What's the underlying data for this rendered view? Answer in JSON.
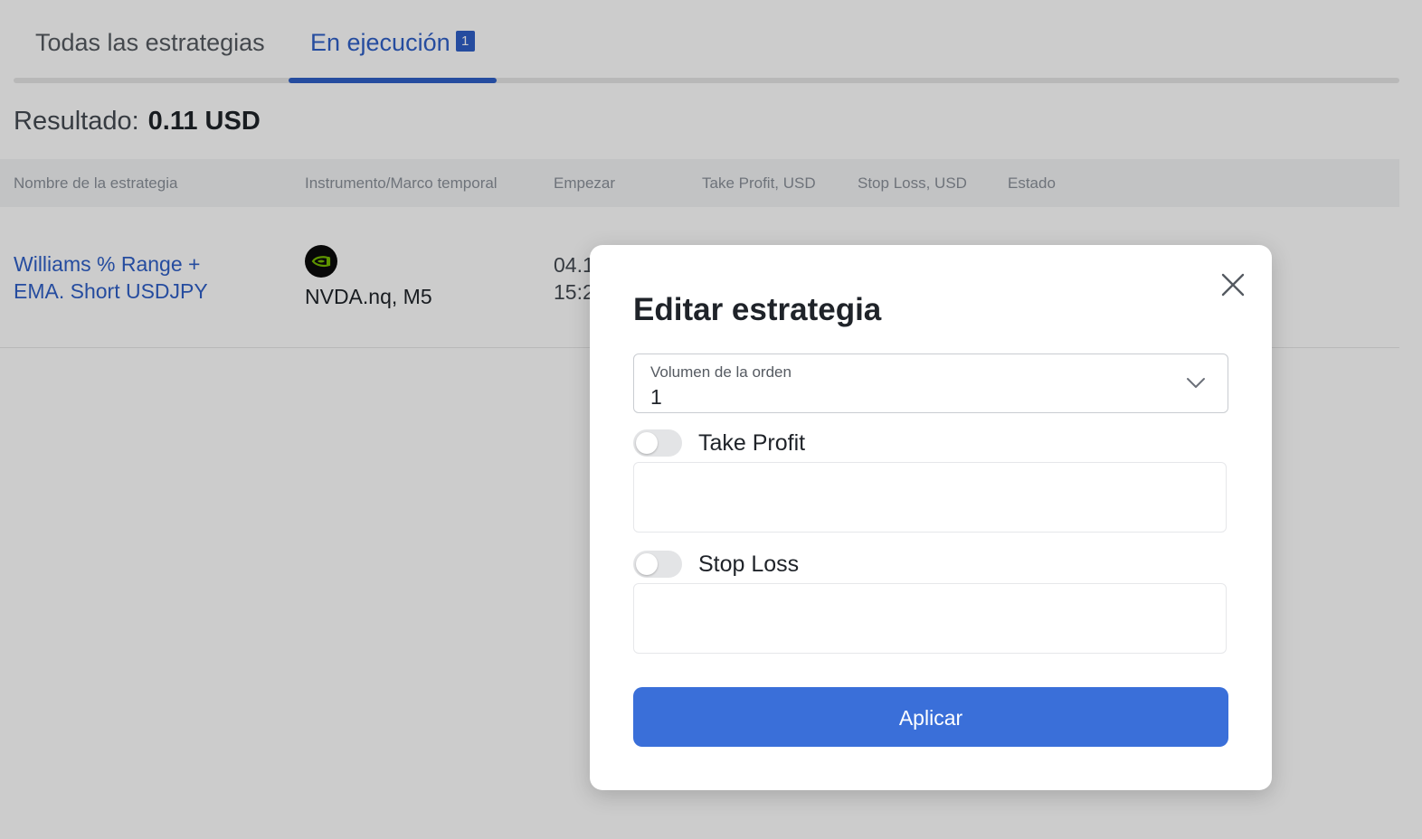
{
  "tabs": {
    "all_label": "Todas las estrategias",
    "running_label": "En ejecución",
    "running_count": "1"
  },
  "result": {
    "label": "Resultado:",
    "value": "0.11 USD"
  },
  "table": {
    "columns": [
      "Nombre de la estrategia",
      "Instrumento/Marco temporal",
      "Empezar",
      "Take Profit, USD",
      "Stop Loss, USD",
      "Estado"
    ],
    "rows": [
      {
        "name_line1": "Williams % Range +",
        "name_line2": "EMA. Short USDJPY",
        "instrument_icon": "nvidia-logo-icon",
        "instrument": "NVDA.nq, M5",
        "start_line1": "04.1",
        "start_line2": "15:2"
      }
    ]
  },
  "modal": {
    "title": "Editar estrategia",
    "volume_label": "Volumen de la orden",
    "volume_value": "1",
    "take_profit_label": "Take Profit",
    "take_profit_enabled": false,
    "take_profit_value": "",
    "stop_loss_label": "Stop Loss",
    "stop_loss_enabled": false,
    "stop_loss_value": "",
    "apply_label": "Aplicar",
    "close_icon": "close-icon"
  },
  "colors": {
    "accent": "#2f5fc7",
    "button": "#3a6fd9",
    "overlay": "rgba(0,0,0,0.2)",
    "nvidia_green": "#76b900"
  }
}
